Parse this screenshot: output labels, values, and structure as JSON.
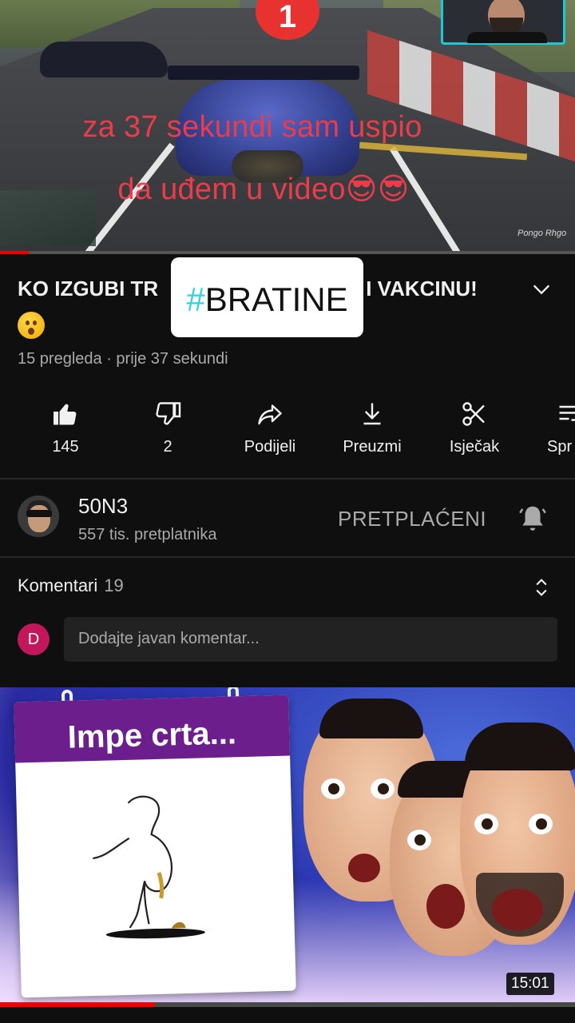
{
  "video": {
    "position_badge": "1",
    "caption_line1": "za 37 sekundi sam uspio",
    "caption_line2": "da uđem u video😎😎",
    "watermark": "Pongo Rhgo",
    "progress_fraction": 0.05
  },
  "sticker": {
    "hash": "#",
    "text": "BRATINE"
  },
  "info": {
    "title": "KO IZGUBI TR",
    "title_tail": "I VAKCINU!",
    "meta": "15 pregleda · prije 37 sekundi"
  },
  "actions": [
    {
      "icon": "thumbs-up-icon",
      "label": "145"
    },
    {
      "icon": "thumbs-down-icon",
      "label": "2"
    },
    {
      "icon": "share-icon",
      "label": "Podijeli"
    },
    {
      "icon": "download-icon",
      "label": "Preuzmi"
    },
    {
      "icon": "scissors-icon",
      "label": "Isječak"
    },
    {
      "icon": "save-icon",
      "label": "Spr"
    }
  ],
  "channel": {
    "name": "50N3",
    "subscribers": "557 tis. pretplatnika",
    "subscribed_label": "PRETPLAĆENI"
  },
  "comments": {
    "title": "Komentari",
    "count": "19",
    "user_initial": "D",
    "placeholder": "Dodajte javan komentar..."
  },
  "next_video": {
    "board_text": "Impe crta...",
    "duration": "15:01",
    "progress_fraction": 0.27
  },
  "colors": {
    "background": "#0f0f0f",
    "caption": "#ea3c4a",
    "accent_red": "#ff0000",
    "sticker_hash": "#2ed3de",
    "comment_avatar": "#c2185b"
  }
}
